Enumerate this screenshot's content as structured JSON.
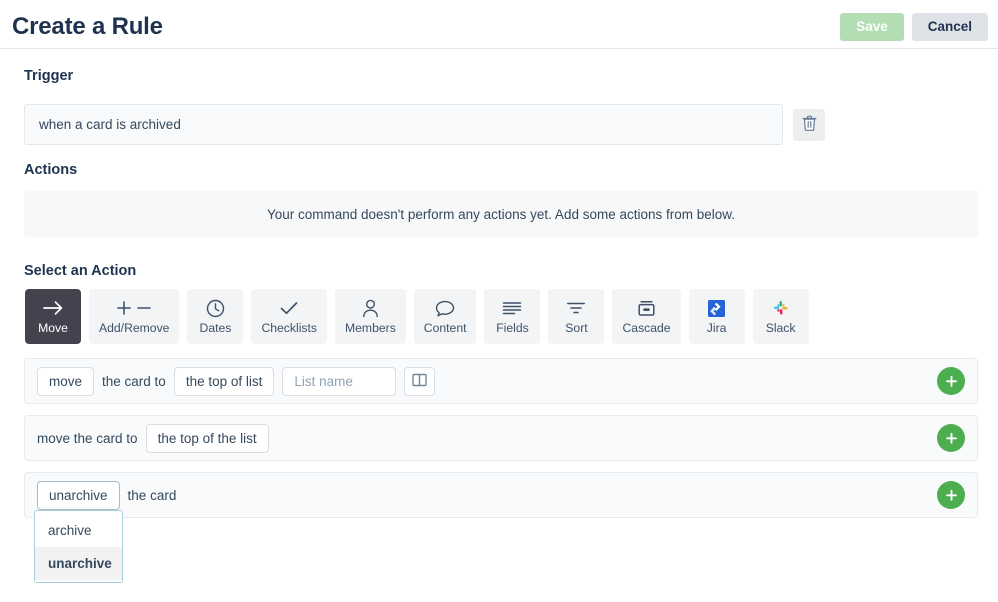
{
  "header": {
    "title": "Create a Rule",
    "save_label": "Save",
    "cancel_label": "Cancel"
  },
  "trigger": {
    "section_label": "Trigger",
    "value": "when a card is archived",
    "delete_icon": "trash-icon"
  },
  "actions": {
    "section_label": "Actions",
    "empty_message": "Your command doesn't perform any actions yet. Add some actions from below."
  },
  "select_action": {
    "section_label": "Select an Action",
    "tabs": [
      {
        "label": "Move",
        "icon": "arrow-right-icon",
        "active": true
      },
      {
        "label": "Add/Remove",
        "icon": "plus-minus-icon",
        "active": false
      },
      {
        "label": "Dates",
        "icon": "clock-icon",
        "active": false
      },
      {
        "label": "Checklists",
        "icon": "check-icon",
        "active": false
      },
      {
        "label": "Members",
        "icon": "person-icon",
        "active": false
      },
      {
        "label": "Content",
        "icon": "speech-bubble-icon",
        "active": false
      },
      {
        "label": "Fields",
        "icon": "list-lines-icon",
        "active": false
      },
      {
        "label": "Sort",
        "icon": "funnel-icon",
        "active": false
      },
      {
        "label": "Cascade",
        "icon": "archive-box-icon",
        "active": false
      },
      {
        "label": "Jira",
        "icon": "jira-icon",
        "active": false
      },
      {
        "label": "Slack",
        "icon": "slack-icon",
        "active": false
      }
    ]
  },
  "command_rows": [
    {
      "verb": "move",
      "text_after_verb": "the card to",
      "position": "the top of list",
      "list_name_placeholder": "List name",
      "list_name_value": "",
      "board_icon": "board-columns-icon",
      "add_label": "+"
    },
    {
      "text": "move the card to",
      "position": "the top of the list",
      "add_label": "+"
    },
    {
      "verb": "unarchive",
      "text_after_verb": "the card",
      "add_label": "+",
      "dropdown": {
        "open": true,
        "options": [
          {
            "label": "archive",
            "selected": false
          },
          {
            "label": "unarchive",
            "selected": true
          }
        ]
      }
    }
  ],
  "colors": {
    "accent_green": "#4cae4f",
    "save_disabled": "#b3ddb3",
    "active_tab": "#45424f",
    "text": "#35495c",
    "heading": "#1f3350",
    "dropdown_border": "#a8cfe0"
  }
}
